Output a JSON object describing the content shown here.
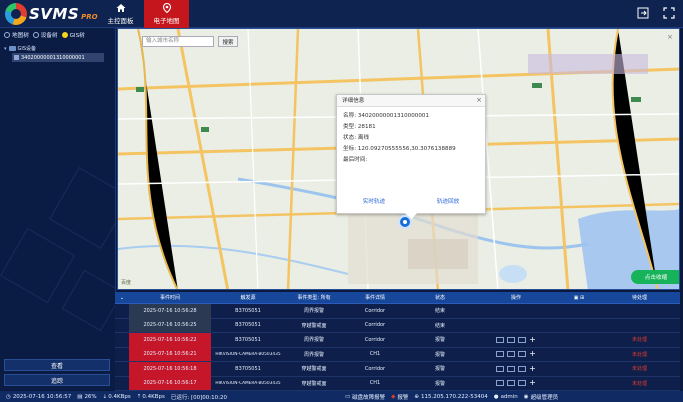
{
  "app": {
    "logo_text": "SVMS",
    "logo_sub": "PRO"
  },
  "nav": [
    {
      "label": "主控面板",
      "icon": "home-icon"
    },
    {
      "label": "电子地图",
      "icon": "map-pin-icon"
    }
  ],
  "sidebar": {
    "tabs": [
      {
        "label": "地图树",
        "selected": false
      },
      {
        "label": "设备树",
        "selected": false
      },
      {
        "label": "GIS树",
        "selected": true
      }
    ],
    "tree_root": "GIS设备",
    "tree_child": "34020000001310000001",
    "btn_locate": "查看",
    "btn_track": "追踪"
  },
  "map": {
    "search_placeholder": "输入城市名称",
    "search_button": "搜索",
    "popup_title": "详细信息",
    "popup_close": "×",
    "popup_rows": [
      "名称: 34020000001310000001",
      "类型: 28181",
      "状态: 离线",
      "坐标: 120.09270555556,30.3076138889",
      "最后时间:"
    ],
    "popup_link_1": "实时轨迹",
    "popup_link_2": "轨迹回放",
    "collapse_button": "点击收缩",
    "zoom_icon": "×",
    "copyright": "百度"
  },
  "table": {
    "headers": [
      "事件时间",
      "触发源",
      "事件类型: 所有",
      "事件详情",
      "状态",
      "操作",
      "待处理"
    ],
    "rows": [
      {
        "time": "2025-07-16 10:56:28",
        "source": "B3705051",
        "type": "周界报警",
        "detail": "Corridor",
        "status": "结束",
        "action": "",
        "style": "dark"
      },
      {
        "time": "2025-07-16 10:56:25",
        "source": "B3705051",
        "type": "穿越警戒面",
        "detail": "Corridor",
        "status": "结束",
        "action": "",
        "style": "dark"
      },
      {
        "time": "2025-07-16 10:56:22",
        "source": "B3705051",
        "type": "周界报警",
        "detail": "Corridor",
        "status": "报警",
        "action": "未处理",
        "style": "red"
      },
      {
        "time": "2025-07-16 10:56:21",
        "source": "HIKVISION-CAMERA-B0503435",
        "type": "周界报警",
        "detail": "CH1",
        "status": "报警",
        "action": "未处理",
        "style": "red"
      },
      {
        "time": "2025-07-16 10:56:18",
        "source": "B3705051",
        "type": "穿越警戒面",
        "detail": "Corridor",
        "status": "报警",
        "action": "未处理",
        "style": "red"
      },
      {
        "time": "2025-07-16 10:56:17",
        "source": "HIKVISION-CAMERA-B0503435",
        "type": "穿越警戒面",
        "detail": "CH1",
        "status": "报警",
        "action": "未处理",
        "style": "red"
      }
    ]
  },
  "status_bar": {
    "datetime": "2025-07-16 10:56:57",
    "cpu": "26%",
    "net_down": "0.4KBps",
    "net_up": "0.4KBps",
    "uptime_label": "已运行: [00]00:10:20",
    "disk_alarm": "磁盘故障报警",
    "alarm": "报警",
    "ip": "115.205.170.222-53404",
    "user": "admin",
    "role": "超级管理员"
  },
  "colors": {
    "accent_red": "#c4161c",
    "header_blue": "#17479b",
    "bg": "#0b1a3c"
  }
}
